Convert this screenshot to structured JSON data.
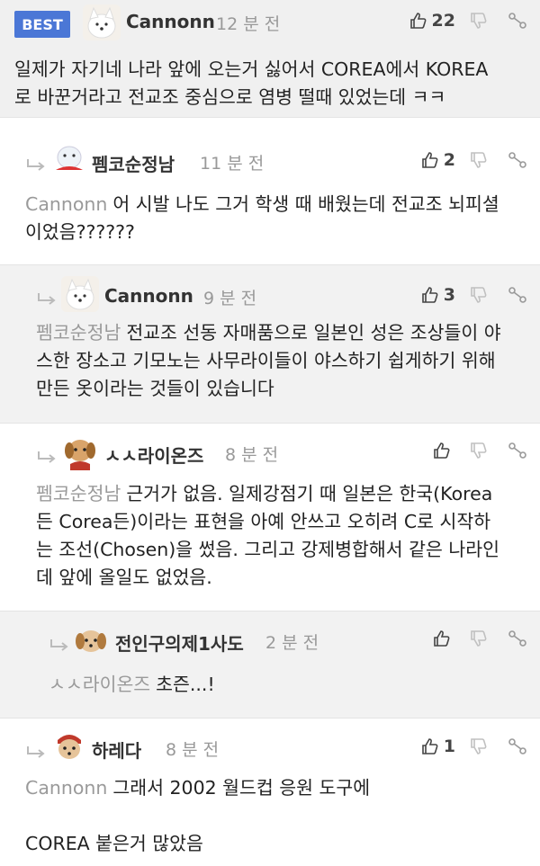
{
  "best_label": "BEST",
  "comments": [
    {
      "nick": "Cannonn",
      "time": "12 분 전",
      "likes": "22",
      "lines": [
        "일제가 자기네 나라 앞에 오는거 싫어서 COREA에서 KOREA",
        "로 바꾼거라고 전교조 중심으로 염병 떨때 있었는데 ㅋㅋ"
      ]
    },
    {
      "nick": "펨코순정남",
      "time": "11 분 전",
      "likes": "2",
      "mention": "Cannonn",
      "lines": [
        "어 시발 나도 그거 학생 때 배웠는데 전교조 뇌피셜",
        "이었음??????"
      ]
    },
    {
      "nick": "Cannonn",
      "time": "9 분 전",
      "likes": "3",
      "mention": "펨코순정남",
      "lines": [
        "전교조 선동 자매품으로 일본인 성은 조상들이 야",
        "스한 장소고 기모노는 사무라이들이 야스하기 쉽게하기 위해",
        "만든 옷이라는 것들이 있습니다"
      ]
    },
    {
      "nick": "ㅅㅅ라이온즈",
      "time": "8 분 전",
      "likes": "",
      "mention": "펨코순정남",
      "lines": [
        "근거가 없음. 일제강점기 때 일본은 한국(Korea",
        "든 Corea든)이라는 표현을 아예 안쓰고 오히려 C로 시작하",
        "는 조선(Chosen)을 썼음. 그리고 강제병합해서 같은 나라인",
        "데 앞에 올일도 없었음."
      ]
    },
    {
      "nick": "전인구의제1사도",
      "time": "2 분 전",
      "likes": "",
      "mention": "ㅅㅅ라이온즈",
      "lines": [
        "초즌...!"
      ]
    },
    {
      "nick": "하레다",
      "time": "8 분 전",
      "likes": "1",
      "mention": "Cannonn",
      "lines": [
        "그래서 2002 월드컵 응원 도구에",
        "",
        "COREA 붙은거 많았음"
      ]
    }
  ]
}
